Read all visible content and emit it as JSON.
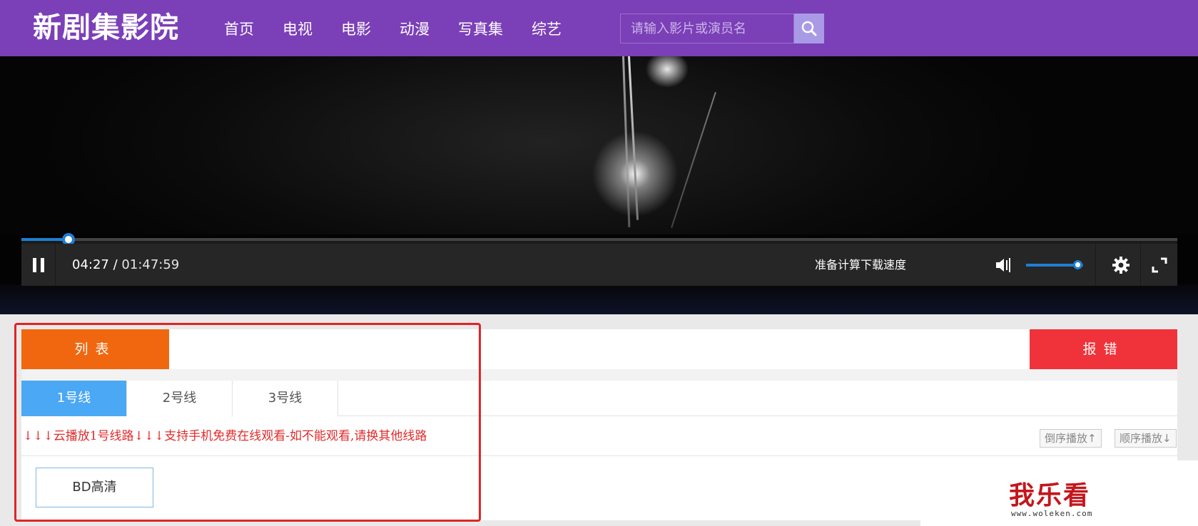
{
  "header": {
    "logo": "新剧集影院",
    "nav": [
      "首页",
      "电视",
      "电影",
      "动漫",
      "写真集",
      "综艺"
    ],
    "search_placeholder": "请输入影片或演员名",
    "accent_color": "#7b3fb8"
  },
  "player": {
    "current_time": "04:27",
    "separator": "/",
    "duration": "01:47:59",
    "progress_fraction": 0.041,
    "speed_status": "准备计算下载速度",
    "volume_fraction": 0.9,
    "icons": [
      "pause-icon",
      "volume-icon",
      "gear-icon",
      "fullscreen-icon"
    ],
    "progress_color": "#1f7fd4"
  },
  "panel": {
    "list_label": "列表",
    "report_label": "报错",
    "lines": [
      "1号线",
      "2号线",
      "3号线"
    ],
    "active_line": 0,
    "notice": "↓↓↓云播放1号线路↓↓↓支持手机免费在线观看-如不能观看,请换其他线路",
    "reverse_order": "倒序播放↑",
    "forward_order": "顺序播放↓",
    "episodes": [
      "BD高清"
    ]
  },
  "watermark": {
    "text": "我乐看",
    "url": "www.woleken.com"
  }
}
